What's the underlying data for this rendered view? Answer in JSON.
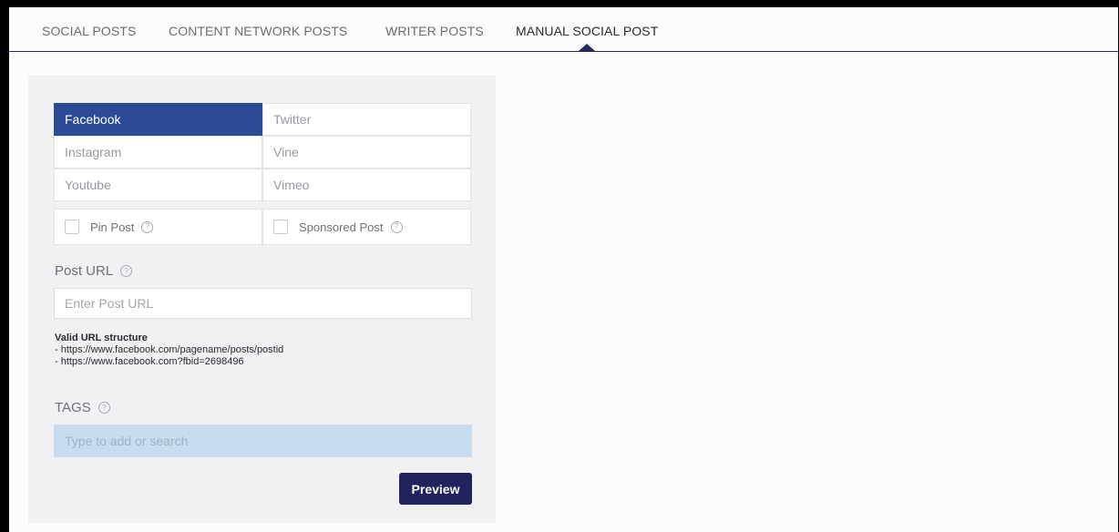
{
  "tabs": [
    {
      "label": "SOCIAL POSTS"
    },
    {
      "label": "CONTENT NETWORK POSTS"
    },
    {
      "label": "WRITER POSTS"
    },
    {
      "label": "MANUAL SOCIAL POST"
    }
  ],
  "platforms": [
    "Facebook",
    "Twitter",
    "Instagram",
    "Vine",
    "Youtube",
    "Vimeo"
  ],
  "selected_platform": "Facebook",
  "checkboxes": {
    "pin_post": "Pin Post",
    "sponsored_post": "Sponsored Post"
  },
  "post_url": {
    "label": "Post URL",
    "placeholder": "Enter Post URL"
  },
  "url_hint": {
    "title": "Valid URL structure",
    "line1": "- https://www.facebook.com/pagename/posts/postid",
    "line2": "- https://www.facebook.com?fbid=2698496"
  },
  "tags": {
    "label": "TAGS",
    "placeholder": "Type to add or search"
  },
  "preview_button": "Preview",
  "help_glyph": "?",
  "colors": {
    "selected": "#2c4b96",
    "button": "#22225c",
    "tags_bg": "#c9dcee"
  }
}
